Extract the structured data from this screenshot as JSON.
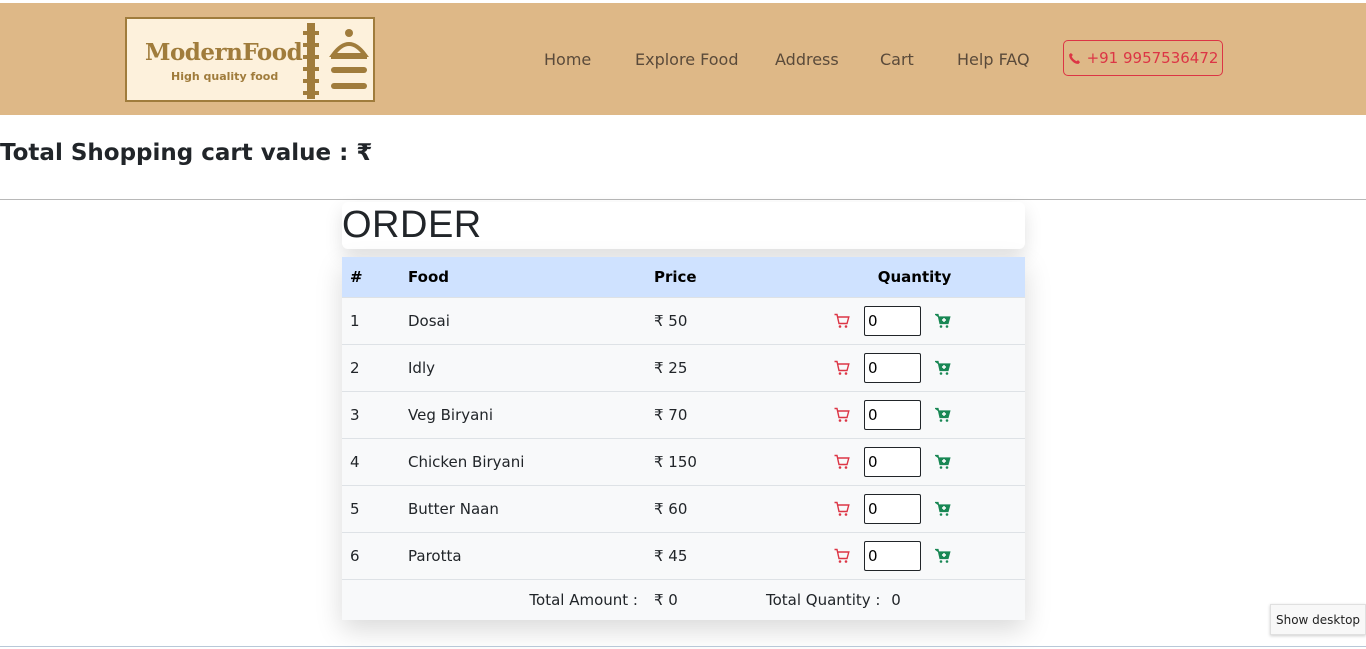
{
  "header": {
    "logo": {
      "title": "ModernFood",
      "subtitle": "High quality food"
    },
    "nav": [
      {
        "label": "Home"
      },
      {
        "label": "Explore Food"
      },
      {
        "label": "Address"
      },
      {
        "label": "Cart"
      },
      {
        "label": "Help FAQ"
      }
    ],
    "phone": "+91 9957536472",
    "bg_color": "#deb887",
    "phone_color": "#dc3545"
  },
  "summary": {
    "label": "Total Shopping cart value : ₹"
  },
  "order": {
    "title": "ORDER",
    "columns": [
      "#",
      "Food",
      "Price",
      "Quantity"
    ],
    "rows": [
      {
        "num": "1",
        "food": "Dosai",
        "price": "₹ 50",
        "qty": "0"
      },
      {
        "num": "2",
        "food": "Idly",
        "price": "₹ 25",
        "qty": "0"
      },
      {
        "num": "3",
        "food": "Veg Biryani",
        "price": "₹ 70",
        "qty": "0"
      },
      {
        "num": "4",
        "food": "Chicken Biryani",
        "price": "₹ 150",
        "qty": "0"
      },
      {
        "num": "5",
        "food": "Butter Naan",
        "price": "₹ 60",
        "qty": "0"
      },
      {
        "num": "6",
        "food": "Parotta",
        "price": "₹ 45",
        "qty": "0"
      }
    ],
    "footer": {
      "total_amount_label": "Total Amount :",
      "total_amount_value": "₹ 0",
      "total_quantity_label": "Total Quantity :",
      "total_quantity_value": "0"
    },
    "header_bg": "#cfe2ff",
    "remove_icon_color": "#dc3545",
    "add_icon_color": "#198754"
  },
  "taskbar": {
    "show_desktop": "Show desktop"
  }
}
